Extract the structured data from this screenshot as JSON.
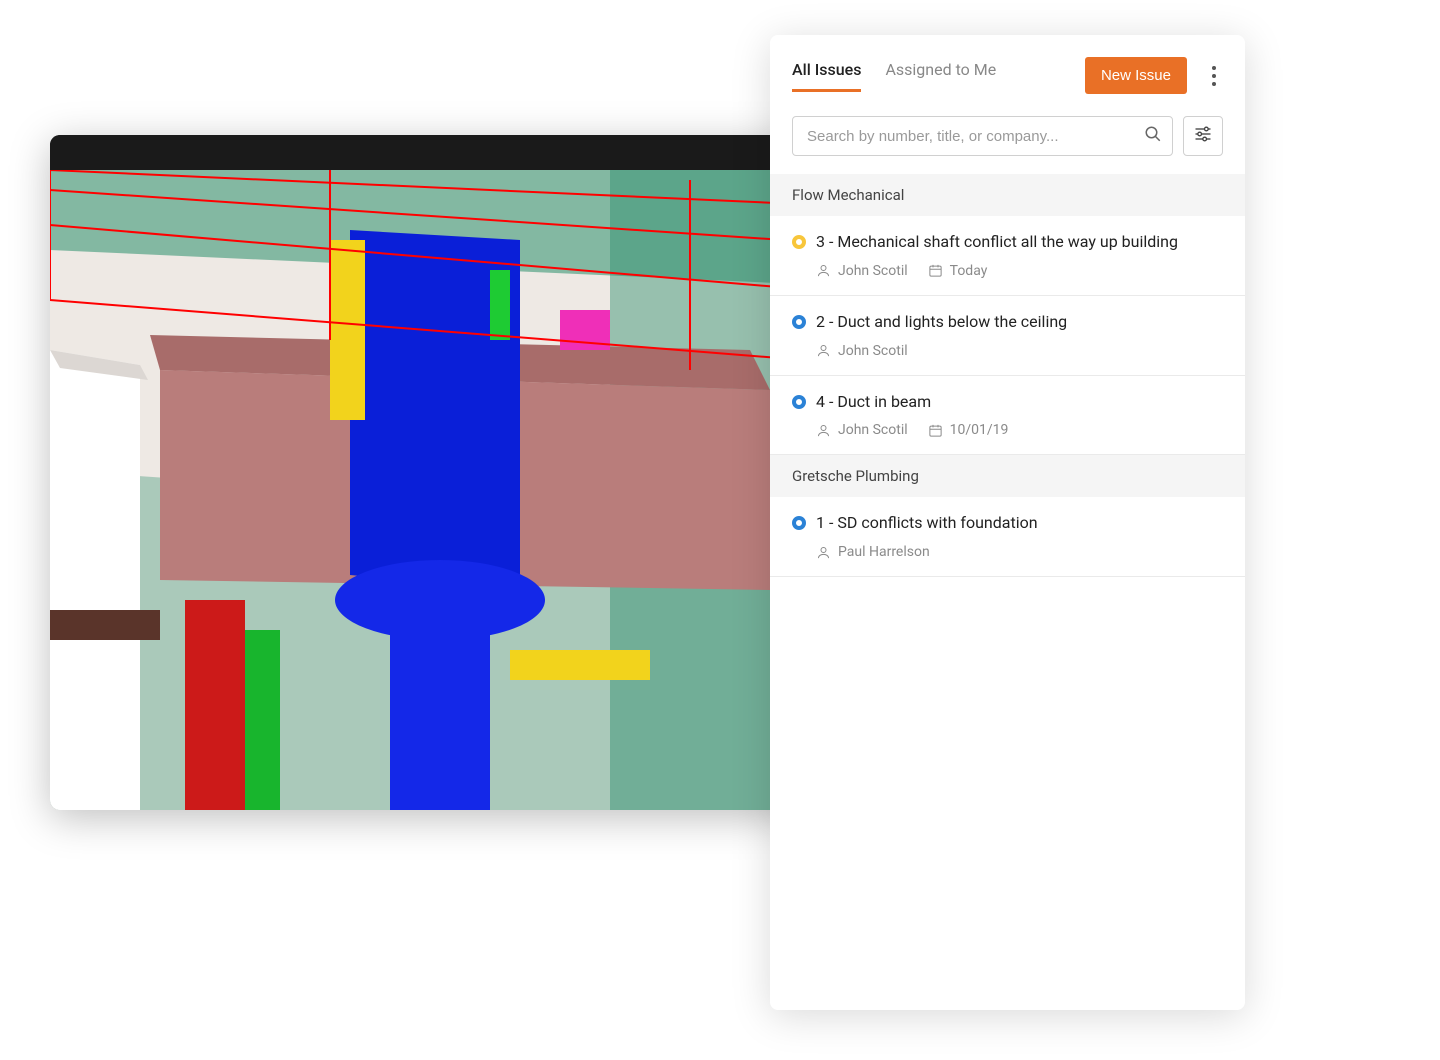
{
  "panel": {
    "tabs": [
      {
        "label": "All Issues",
        "active": true
      },
      {
        "label": "Assigned to Me",
        "active": false
      }
    ],
    "newIssueLabel": "New Issue",
    "searchPlaceholder": "Search by number, title, or company...",
    "groups": [
      {
        "name": "Flow Mechanical",
        "issues": [
          {
            "status": "amber",
            "title": "3 - Mechanical shaft conflict all the way up building",
            "assignee": "John Scotil",
            "date": "Today"
          },
          {
            "status": "blue",
            "title": "2 - Duct and lights below the ceiling",
            "assignee": "John Scotil",
            "date": ""
          },
          {
            "status": "blue",
            "title": "4 - Duct in beam",
            "assignee": "John Scotil",
            "date": "10/01/19"
          }
        ]
      },
      {
        "name": "Gretsche Plumbing",
        "issues": [
          {
            "status": "blue",
            "title": "1 - SD conflicts with foundation",
            "assignee": "Paul Harrelson",
            "date": ""
          }
        ]
      }
    ]
  }
}
